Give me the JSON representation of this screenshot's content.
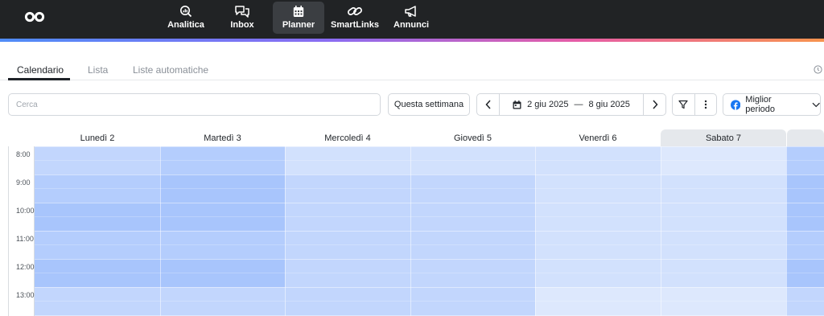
{
  "nav": {
    "items": [
      {
        "label": "Analitica",
        "icon": "analytics-search-icon"
      },
      {
        "label": "Inbox",
        "icon": "chat-bubbles-icon"
      },
      {
        "label": "Planner",
        "icon": "calendar-grid-icon",
        "active": true
      },
      {
        "label": "SmartLinks",
        "icon": "link-icon"
      },
      {
        "label": "Annunci",
        "icon": "megaphone-icon"
      }
    ]
  },
  "tabs": {
    "items": [
      {
        "label": "Calendario",
        "active": true
      },
      {
        "label": "Lista"
      },
      {
        "label": "Liste automatiche"
      }
    ]
  },
  "toolbar": {
    "search_placeholder": "Cerca",
    "this_week_label": "Questa settimana",
    "date_start": "2 giu 2025",
    "date_separator": "—",
    "date_end": "8 giu 2025",
    "best_time_label": "Miglior periodo"
  },
  "calendar": {
    "days": [
      "Lunedì 2",
      "Martedì 3",
      "Mercoledì 4",
      "Giovedì 5",
      "Venerdì 6",
      "Sabato 7"
    ],
    "times": [
      "8:00",
      "9:00",
      "10:00",
      "11:00",
      "12:00",
      "13:00"
    ],
    "heat_levels": [
      [
        2,
        3,
        1,
        1,
        1,
        0,
        3
      ],
      [
        3,
        4,
        2,
        2,
        1,
        1,
        4
      ],
      [
        4,
        4,
        2,
        2,
        1,
        1,
        4
      ],
      [
        3,
        3,
        2,
        2,
        1,
        1,
        3
      ],
      [
        4,
        4,
        2,
        2,
        1,
        1,
        4
      ],
      [
        2,
        2,
        2,
        2,
        0,
        0,
        2
      ]
    ]
  },
  "colors": {
    "topbar": "#212325",
    "heat": [
      "#dde8fd",
      "#d2e1fd",
      "#c2d6fd",
      "#b4cdfd",
      "#a8c5fc"
    ]
  }
}
